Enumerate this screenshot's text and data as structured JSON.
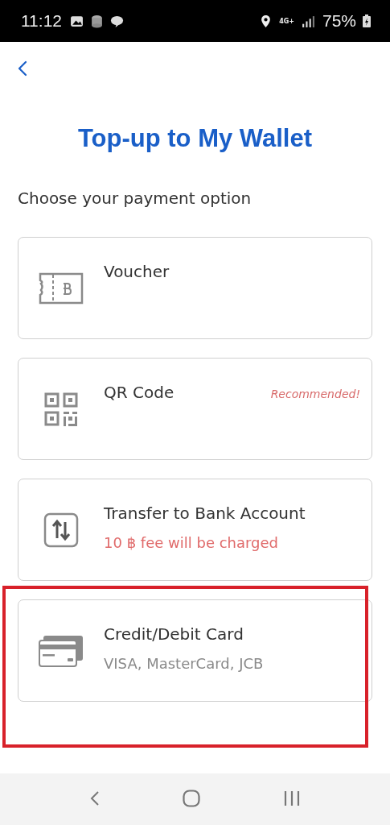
{
  "status_bar": {
    "time": "11:12",
    "network": "4G+",
    "battery": "75%"
  },
  "title": "Top-up to My Wallet",
  "subtitle": "Choose your payment option",
  "options": [
    {
      "kind": "voucher",
      "label": "Voucher",
      "highlighted": false
    },
    {
      "kind": "qr",
      "label": "QR Code",
      "badge": "Recommended!",
      "highlighted": false
    },
    {
      "kind": "transfer",
      "label": "Transfer to Bank Account",
      "note": "10 ฿ fee will be charged",
      "warning": true,
      "highlighted": false
    },
    {
      "kind": "card",
      "label": "Credit/Debit Card",
      "note": "VISA, MasterCard, JCB",
      "warning": false,
      "highlighted": true
    }
  ]
}
